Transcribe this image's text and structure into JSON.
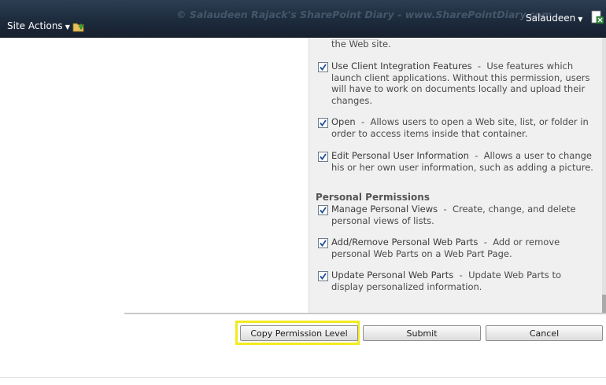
{
  "ribbon": {
    "site_actions_label": "Site Actions",
    "watermark": "© Salaudeen Rajack's SharePoint Diary - www.SharePointDiary.com",
    "user_name": "Salaudeen"
  },
  "permissions": {
    "partial_top_text": "the Web site.",
    "items": [
      {
        "name": "Use Client Integration Features",
        "desc_line1": "Use features which",
        "line2": "launch client applications. Without this permission, users",
        "line3": "will have to work on documents locally and upload their",
        "line4": "changes.",
        "checked": true
      },
      {
        "name": "Open",
        "desc_line1": "Allows users to open a Web site, list, or folder in",
        "line2": "order to access items inside that container.",
        "checked": true
      },
      {
        "name": "Edit Personal User Information",
        "desc_line1": "Allows a user to change",
        "line2": "his or her own user information, such as adding a picture.",
        "checked": true
      }
    ],
    "personal_heading": "Personal Permissions",
    "personal_items": [
      {
        "name": "Manage Personal Views",
        "desc_line1": "Create, change, and delete",
        "line2": "personal views of lists.",
        "checked": true
      },
      {
        "name": "Add/Remove Personal Web Parts",
        "desc_line1": "Add or remove",
        "line2": "personal Web Parts on a Web Part Page.",
        "checked": true
      },
      {
        "name": "Update Personal Web Parts",
        "desc_line1": "Update Web Parts to",
        "line2": "display personalized information.",
        "checked": true
      }
    ],
    "separator": "-"
  },
  "buttons": {
    "copy": "Copy Permission Level",
    "submit": "Submit",
    "cancel": "Cancel"
  },
  "colors": {
    "ribbon_bg": "#1d2b3d",
    "highlight": "#f2ea1f",
    "check": "#1f4e9a"
  }
}
